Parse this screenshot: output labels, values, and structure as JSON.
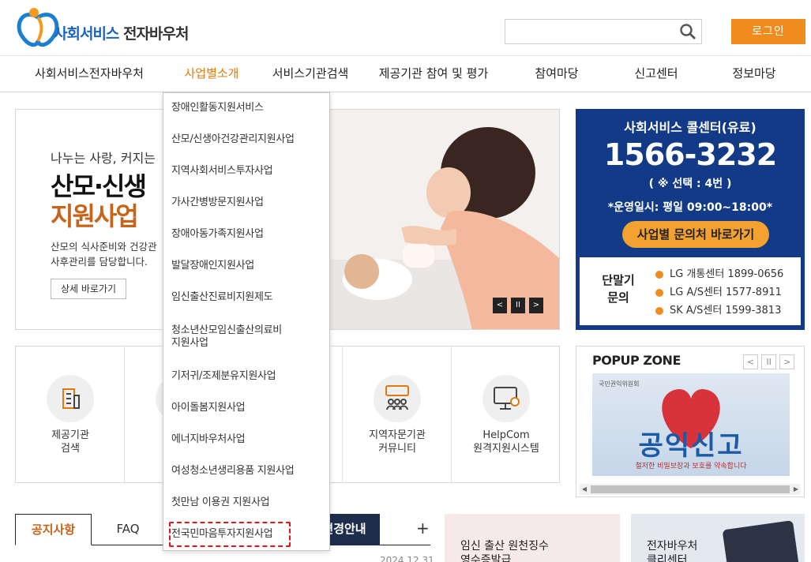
{
  "header": {
    "logo_part1": "사회서비스",
    "logo_part2": "전자바우처",
    "search_placeholder": "",
    "login_label": "로그인"
  },
  "nav": [
    {
      "label": "사회서비스전자바우처",
      "active": false
    },
    {
      "label": "사업별소개",
      "active": true
    },
    {
      "label": "서비스기관검색",
      "active": false
    },
    {
      "label": "제공기관 참여 및 평가",
      "active": false
    },
    {
      "label": "참여마당",
      "active": false
    },
    {
      "label": "신고센터",
      "active": false
    },
    {
      "label": "정보마당",
      "active": false
    }
  ],
  "dropdown": [
    "장애인활동지원서비스",
    "산모/신생아건강관리지원사업",
    "지역사회서비스투자사업",
    "가사간병방문지원사업",
    "장애아동가족지원사업",
    "발달장애인지원사업",
    "임신출산진료비지원제도",
    "청소년산모임신출산의료비\n지원사업",
    "기저귀/조제분유지원사업",
    "아이돌봄지원사업",
    "에너지바우처사업",
    "여성청소년생리용품 지원사업",
    "첫만남 이용권 지원사업",
    "전국민마음투자지원사업"
  ],
  "banner": {
    "subtitle": "나누는 사랑, 커지는 ",
    "title_line1": "산모·신생",
    "title_line2": "지원사업",
    "desc": "산모의 식사준비와 건강관\n사후관리를 담당합니다.",
    "more_label": "상세 바로가기",
    "prev": "<",
    "pause": "II",
    "next": ">"
  },
  "call_center": {
    "title": "사회서비스 콜센터(유료)",
    "number": "1566-3232",
    "selection": "( ※ 선택 : 4번 )",
    "hours": "*운영일시: 평일 09:00~18:00*",
    "button": "사업별 문의처 바로가기",
    "box_label": "단말기\n문의",
    "lines": [
      "LG 개통센터 1899-0656",
      "LG A/S센터 1577-8911",
      "SK A/S센터 1599-3813"
    ]
  },
  "quick_menu": [
    {
      "label": "제공기관\n검색",
      "icon": "building-icon"
    },
    {
      "label": "",
      "icon": "hidden-icon"
    },
    {
      "label": "",
      "icon": "hidden-icon"
    },
    {
      "label": "지역자문기관\n커뮤니티",
      "icon": "community-icon"
    },
    {
      "label": "HelpCom\n원격지원시스템",
      "icon": "monitor-icon"
    }
  ],
  "popup": {
    "title": "POPUP ZONE",
    "prev": "<",
    "pause": "II",
    "next": ">",
    "image_logo": "국민권익위원회",
    "image_big": "공익신고",
    "image_small": "철저한 비밀보장과 보호를 약속합니다"
  },
  "tabs": [
    {
      "label": "공지사항"
    },
    {
      "label": "FAQ"
    },
    {
      "label": "변경안내"
    }
  ],
  "tabs_plus": "+",
  "notice_date": "2024.12.31",
  "promo1": "임신 출산 원천징수\n영수증발급",
  "promo2": "전자바우처\n클리센터"
}
